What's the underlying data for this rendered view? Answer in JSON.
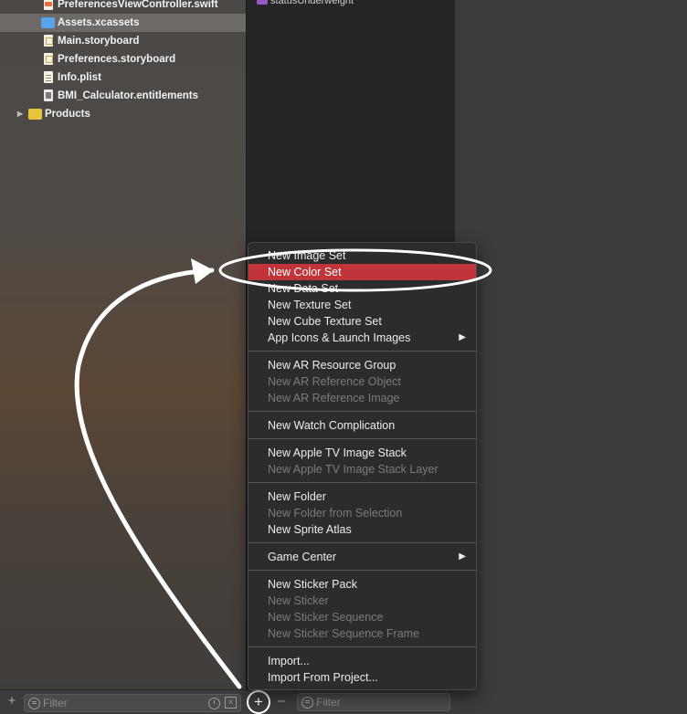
{
  "navigator": {
    "files": [
      {
        "label": "PreferencesViewController.swift",
        "type": "swift"
      },
      {
        "label": "Assets.xcassets",
        "type": "xcassets",
        "selected": true
      },
      {
        "label": "Main.storyboard",
        "type": "storyboard"
      },
      {
        "label": "Preferences.storyboard",
        "type": "storyboard"
      },
      {
        "label": "Info.plist",
        "type": "plist"
      },
      {
        "label": "BMI_Calculator.entitlements",
        "type": "entitlements"
      }
    ],
    "group": {
      "label": "Products"
    },
    "filter": {
      "placeholder": "Filter"
    },
    "icons": [
      "plus-icon",
      "filter-icon",
      "clock-icon",
      "scm-icon"
    ]
  },
  "asset_list": {
    "top_item": "statusUnderweight",
    "filter": {
      "placeholder": "Filter"
    },
    "add_label": "+",
    "remove_label": "–"
  },
  "context_menu": {
    "groups": [
      [
        {
          "label": "New Image Set",
          "enabled": true
        },
        {
          "label": "New Color Set",
          "enabled": true,
          "highlighted": true
        },
        {
          "label": "New Data Set",
          "enabled": true
        },
        {
          "label": "New Texture Set",
          "enabled": true
        },
        {
          "label": "New Cube Texture Set",
          "enabled": true
        },
        {
          "label": "App Icons & Launch Images",
          "enabled": true,
          "submenu": true
        }
      ],
      [
        {
          "label": "New AR Resource Group",
          "enabled": true
        },
        {
          "label": "New AR Reference Object",
          "enabled": false
        },
        {
          "label": "New AR Reference Image",
          "enabled": false
        }
      ],
      [
        {
          "label": "New Watch Complication",
          "enabled": true
        }
      ],
      [
        {
          "label": "New Apple TV Image Stack",
          "enabled": true
        },
        {
          "label": "New Apple TV Image Stack Layer",
          "enabled": false
        }
      ],
      [
        {
          "label": "New Folder",
          "enabled": true
        },
        {
          "label": "New Folder from Selection",
          "enabled": false
        },
        {
          "label": "New Sprite Atlas",
          "enabled": true
        }
      ],
      [
        {
          "label": "Game Center",
          "enabled": true,
          "submenu": true
        }
      ],
      [
        {
          "label": "New Sticker Pack",
          "enabled": true
        },
        {
          "label": "New Sticker",
          "enabled": false
        },
        {
          "label": "New Sticker Sequence",
          "enabled": false
        },
        {
          "label": "New Sticker Sequence Frame",
          "enabled": false
        }
      ],
      [
        {
          "label": "Import...",
          "enabled": true
        },
        {
          "label": "Import From Project...",
          "enabled": true
        }
      ]
    ]
  },
  "colors": {
    "highlight": "#c1343a",
    "annotation": "#ffffff",
    "asset_swatch": "#9a57c7"
  }
}
